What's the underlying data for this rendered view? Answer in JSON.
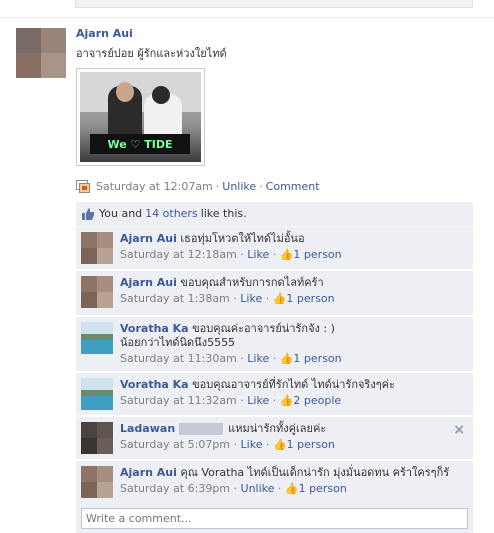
{
  "post": {
    "author": "Ajarn Aui",
    "text": "อาจารย์ปอย ผู้รักและห่วงใยไทด์",
    "photo_sign_text": "We ♡ TIDE",
    "timestamp": "Saturday at 12:07am",
    "unlike_label": "Unlike",
    "comment_label": "Comment",
    "sep": "·"
  },
  "likes": {
    "you_and": "You and ",
    "others_link": "14 others",
    "like_this": " like this."
  },
  "comments": [
    {
      "author": "Ajarn Aui",
      "text": "เธอทุ่มโหวตให้ไทด์ไม่อั้นอ",
      "time": "Saturday at 12:18am",
      "action": "Like",
      "likes": "1 person"
    },
    {
      "author": "Ajarn Aui",
      "text": "ขอบคุณสำหรับการกดไลท์คร้า",
      "time": "Saturday at 1:38am",
      "action": "Like",
      "likes": "1 person"
    },
    {
      "author": "Voratha Ka",
      "text": "ขอบคุณค่ะอาจารย์น่ารักจัง : )",
      "text2": "น้อยกว่าไทด์นิดนึง5555",
      "time": "Saturday at 11:30am",
      "action": "Like",
      "likes": "1 person"
    },
    {
      "author": "Voratha Ka",
      "text": "ขอบคุณอาจารย์ที่รักไทด์ ไทด์น่ารักจริงๆค่ะ",
      "time": "Saturday at 11:32am",
      "action": "Like",
      "likes": "2 people"
    },
    {
      "author": "Ladawan",
      "text": "แหมน่ารักทั้งคู่เลยค่ะ",
      "time": "Saturday at 5:07pm",
      "action": "Like",
      "likes": "1 person"
    },
    {
      "author": "Ajarn Aui",
      "text": "คุณ Voratha ไทด์เป็นเด็กน่ารัก มุ่งมั่นอดทน คร้าใครๆก็รั",
      "time": "Saturday at 6:39pm",
      "action": "Unlike",
      "likes": "1 person"
    }
  ],
  "write_comment_placeholder": "Write a comment...",
  "close_glyph": "×",
  "colors": {
    "link": "#3b5998",
    "ufi_bg": "#edeff4",
    "muted": "#7f7f7f"
  }
}
